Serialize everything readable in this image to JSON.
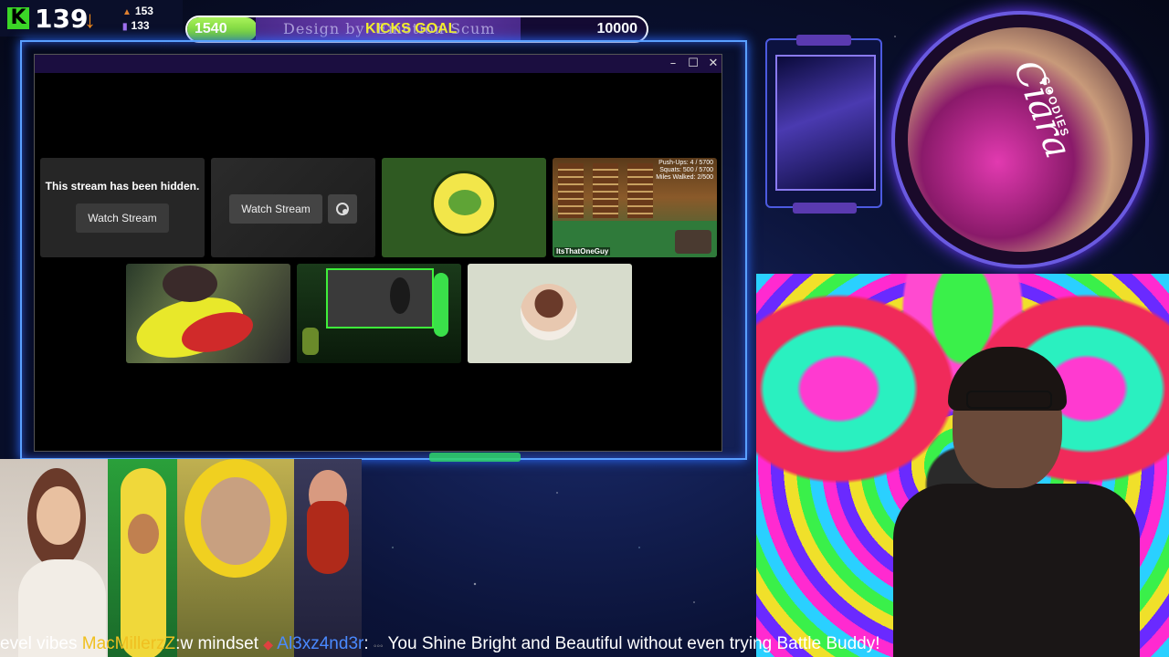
{
  "stats": {
    "viewer_count": "139",
    "stat_followers": "153",
    "stat_subs": "133",
    "colors": {
      "kick": "#3bd627",
      "trend_down": "#f28a1a"
    }
  },
  "goal": {
    "current": "1540",
    "target": "10000",
    "title": "KICKS GOAL",
    "design_credit": "Design by: Emotion Scum",
    "progress_fraction": 0.154
  },
  "window": {
    "controls": [
      "–",
      "☐",
      "✕"
    ],
    "tiles": [
      {
        "kind": "hidden",
        "message": "This stream has been hidden.",
        "button": "Watch Stream"
      },
      {
        "kind": "blurred",
        "button": "Watch Stream",
        "icon": "picture-in-picture-icon"
      },
      {
        "kind": "avatar",
        "icon": "pepe-avatar"
      },
      {
        "kind": "game",
        "overlay_text": "Push-Ups: 4 / 5700\nSquats: 500 / 5700\nMiles Walked: 2/500",
        "tag": "ItsThatOneGuy"
      },
      {
        "kind": "camera"
      },
      {
        "kind": "camera"
      },
      {
        "kind": "avatar",
        "icon": "profile-avatar"
      }
    ]
  },
  "ticker": {
    "segments": [
      {
        "type": "msg",
        "text": "evel vibes "
      },
      {
        "type": "name",
        "text": "MacMillerzZ"
      },
      {
        "type": "msg",
        "text": ":w mindset "
      },
      {
        "type": "name2",
        "text": "Al3xz4nd3r"
      },
      {
        "type": "msg",
        "text": ":"
      },
      {
        "type": "msg",
        "text": " You Shine Bright and Beautiful without even trying Battle Buddy!"
      }
    ],
    "colors": {
      "name": "#f0c020",
      "name2": "#4a8aff"
    }
  },
  "logo": {
    "script": "Ciara",
    "sub": "GOODIES"
  }
}
